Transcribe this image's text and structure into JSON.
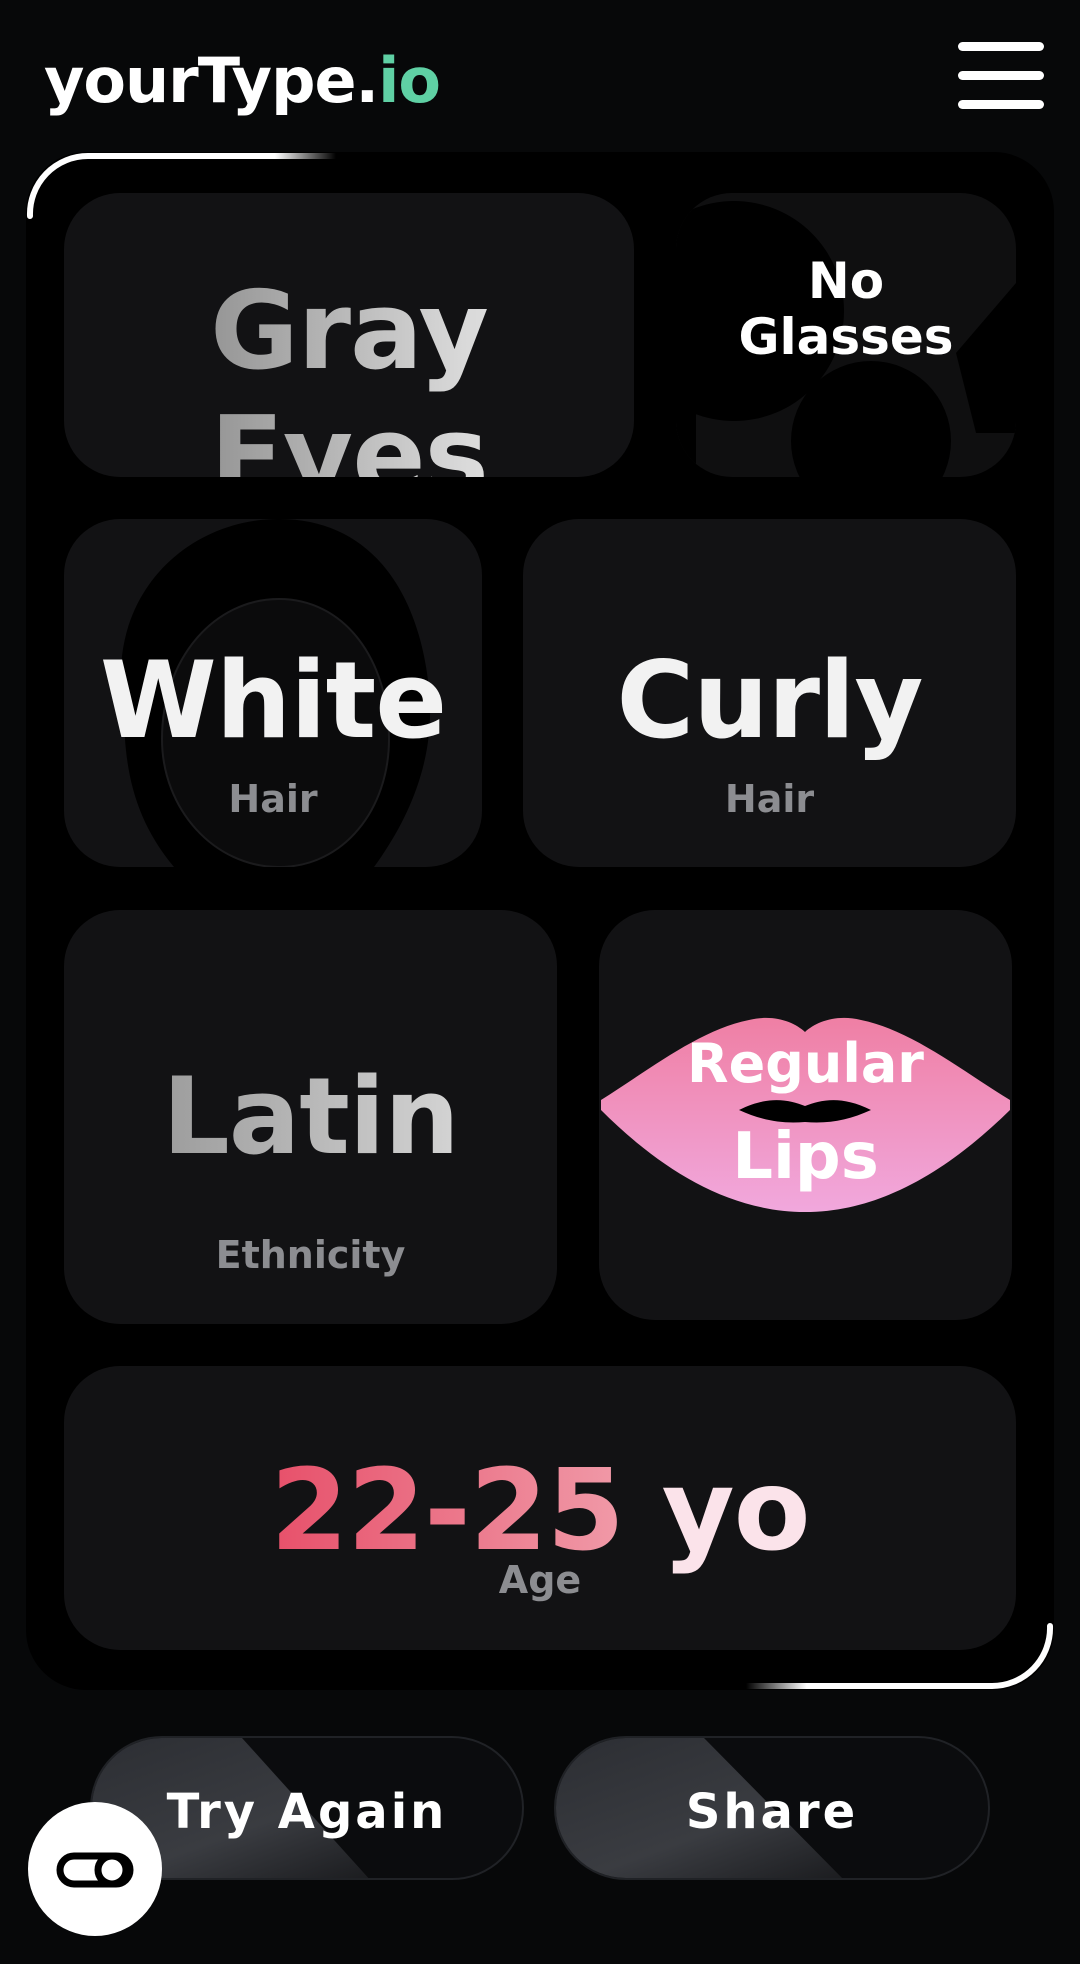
{
  "header": {
    "logo_main": "yourType.",
    "logo_tld": "io",
    "menu_icon": "hamburger-menu-icon"
  },
  "traits": {
    "eyes": {
      "value": "Gray Eyes"
    },
    "glasses": {
      "line1": "No",
      "line2": "Glasses"
    },
    "hair_color": {
      "value": "White",
      "label": "Hair"
    },
    "hair_type": {
      "value": "Curly",
      "label": "Hair"
    },
    "ethnicity": {
      "value": "Latin",
      "label": "Ethnicity"
    },
    "lips": {
      "line1": "Regular",
      "line2": "Lips"
    },
    "age": {
      "range": "22-25",
      "unit": "yo",
      "label": "Age"
    }
  },
  "actions": {
    "try_again": "Try Again",
    "share": "Share"
  },
  "fab": {
    "icon": "link-toggle-icon"
  },
  "colors": {
    "background": "#070809",
    "tile": "#121214",
    "logo_accent": "#5fd0a4",
    "age_gradient_start": "#e7506a",
    "age_gradient_end": "#f09aa8",
    "lips_top": "#ef7fa4",
    "lips_bottom": "#f1a8dd"
  }
}
